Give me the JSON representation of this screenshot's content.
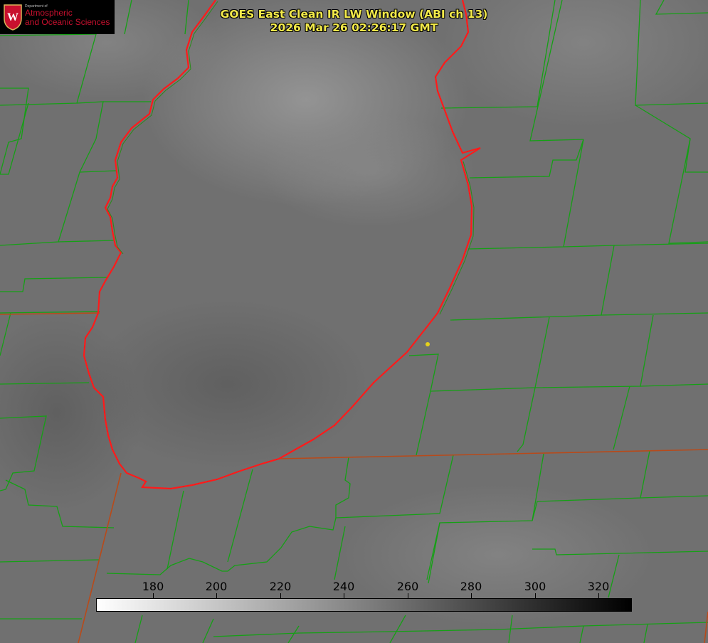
{
  "logo": {
    "department": "Department of",
    "line1": "Atmospheric",
    "line2": "and Oceanic Sciences",
    "shield_letter": "W",
    "shield_color": "#c8102e"
  },
  "title": {
    "line1": "GOES East Clean IR LW Window (ABI ch 13)",
    "line2": "2026 Mar 26 02:26:17 GMT"
  },
  "colorbar": {
    "ticks": [
      "180",
      "200",
      "220",
      "240",
      "260",
      "280",
      "300",
      "320"
    ],
    "gradient": [
      "#ffffff",
      "#000000"
    ]
  },
  "colors": {
    "title": "#f2e94a",
    "county_lines": "#15a015",
    "lake_outline": "#ff1a1a",
    "state_lines": "#b84a1a",
    "marker": "#e6d21a"
  }
}
